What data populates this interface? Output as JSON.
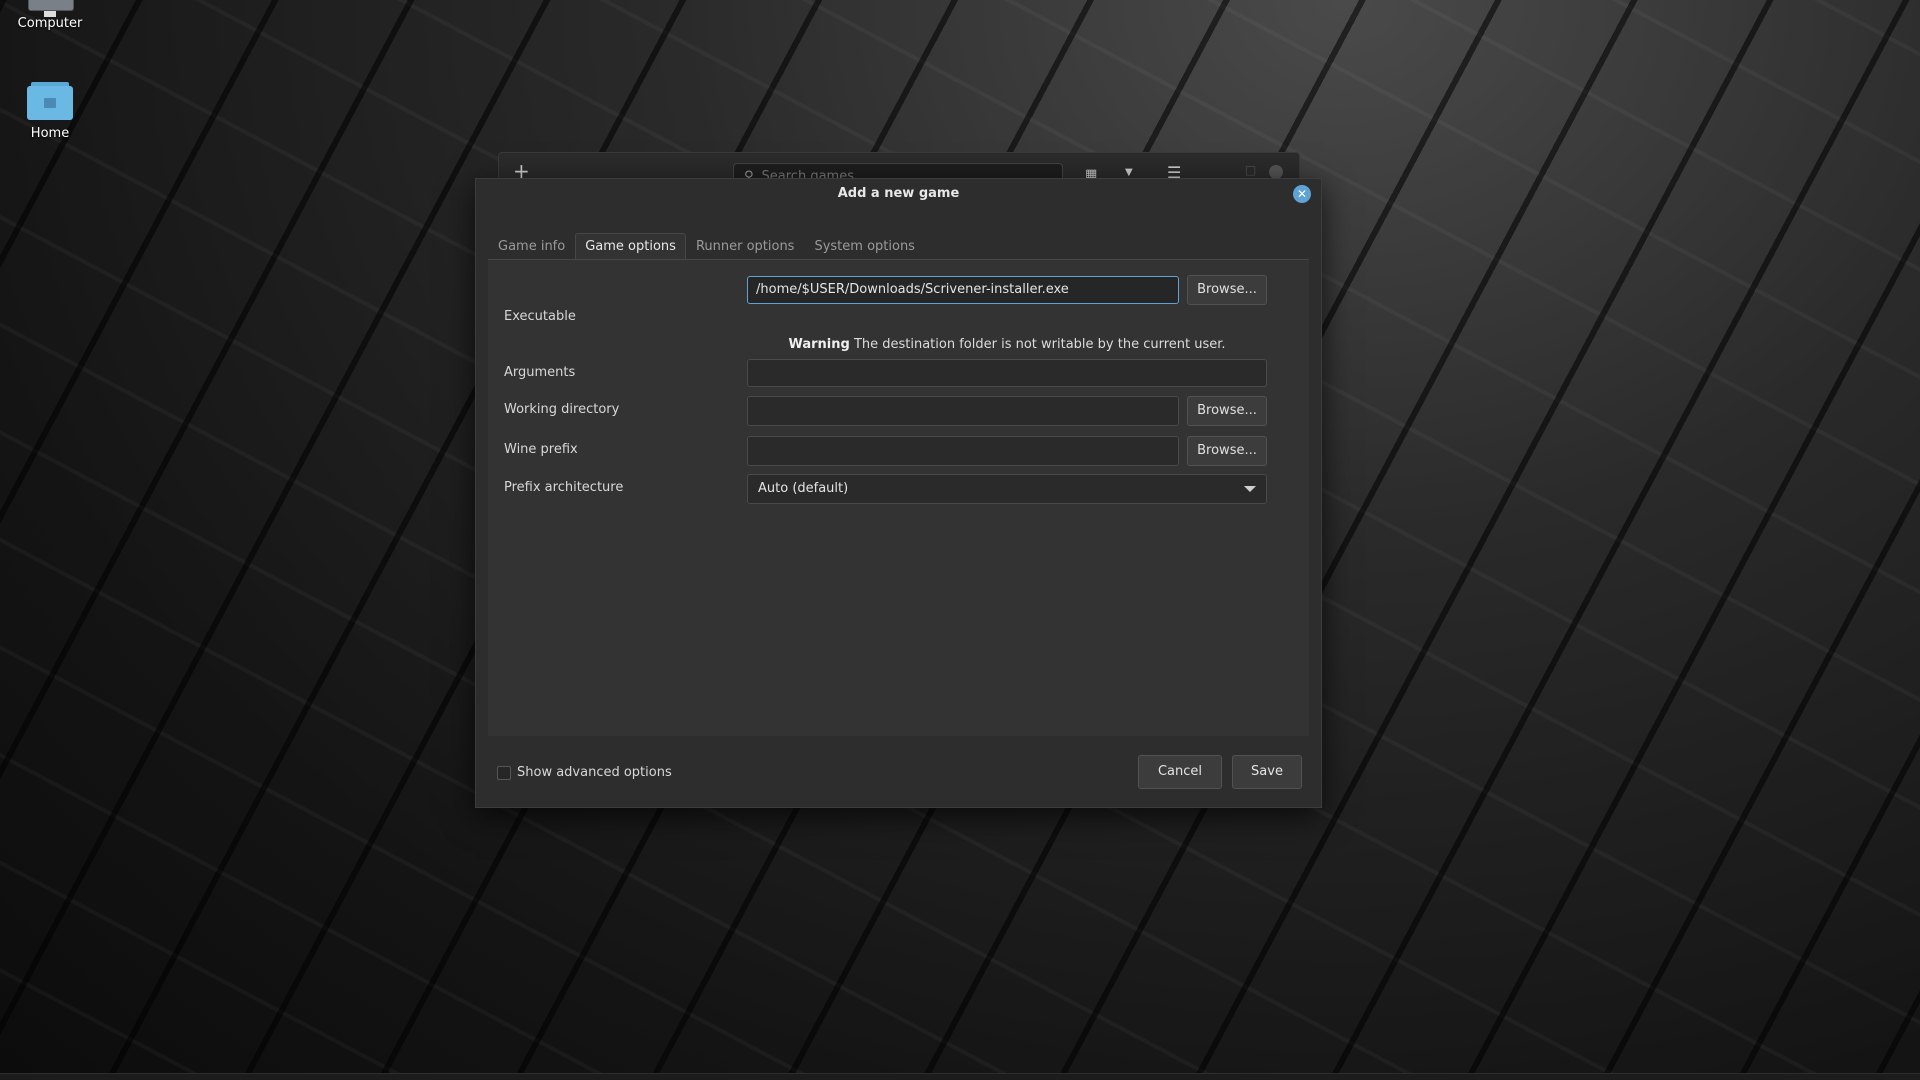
{
  "desktop": {
    "icons": [
      {
        "label": "Computer"
      },
      {
        "label": "Home"
      }
    ]
  },
  "background_window": {
    "search_placeholder": "Search games"
  },
  "dialog": {
    "title": "Add a new game",
    "tabs": [
      {
        "label": "Game info"
      },
      {
        "label": "Game options",
        "active": true
      },
      {
        "label": "Runner options"
      },
      {
        "label": "System options"
      }
    ],
    "fields": {
      "executable": {
        "label": "Executable",
        "value": "/home/$USER/Downloads/Scrivener-installer.exe",
        "browse_label": "Browse..."
      },
      "warning": {
        "strong": "Warning",
        "text": "The destination folder is not writable by the current user."
      },
      "arguments": {
        "label": "Arguments",
        "value": ""
      },
      "working_directory": {
        "label": "Working directory",
        "value": "",
        "browse_label": "Browse..."
      },
      "wine_prefix": {
        "label": "Wine prefix",
        "value": "",
        "browse_label": "Browse..."
      },
      "prefix_architecture": {
        "label": "Prefix architecture",
        "selected": "Auto (default)"
      }
    },
    "footer": {
      "advanced_label": "Show advanced options",
      "advanced_checked": false,
      "cancel_label": "Cancel",
      "save_label": "Save"
    }
  },
  "colors": {
    "accent": "#5fa3d4",
    "dialog_bg": "#2d2d2d",
    "panel_bg": "#333333"
  }
}
